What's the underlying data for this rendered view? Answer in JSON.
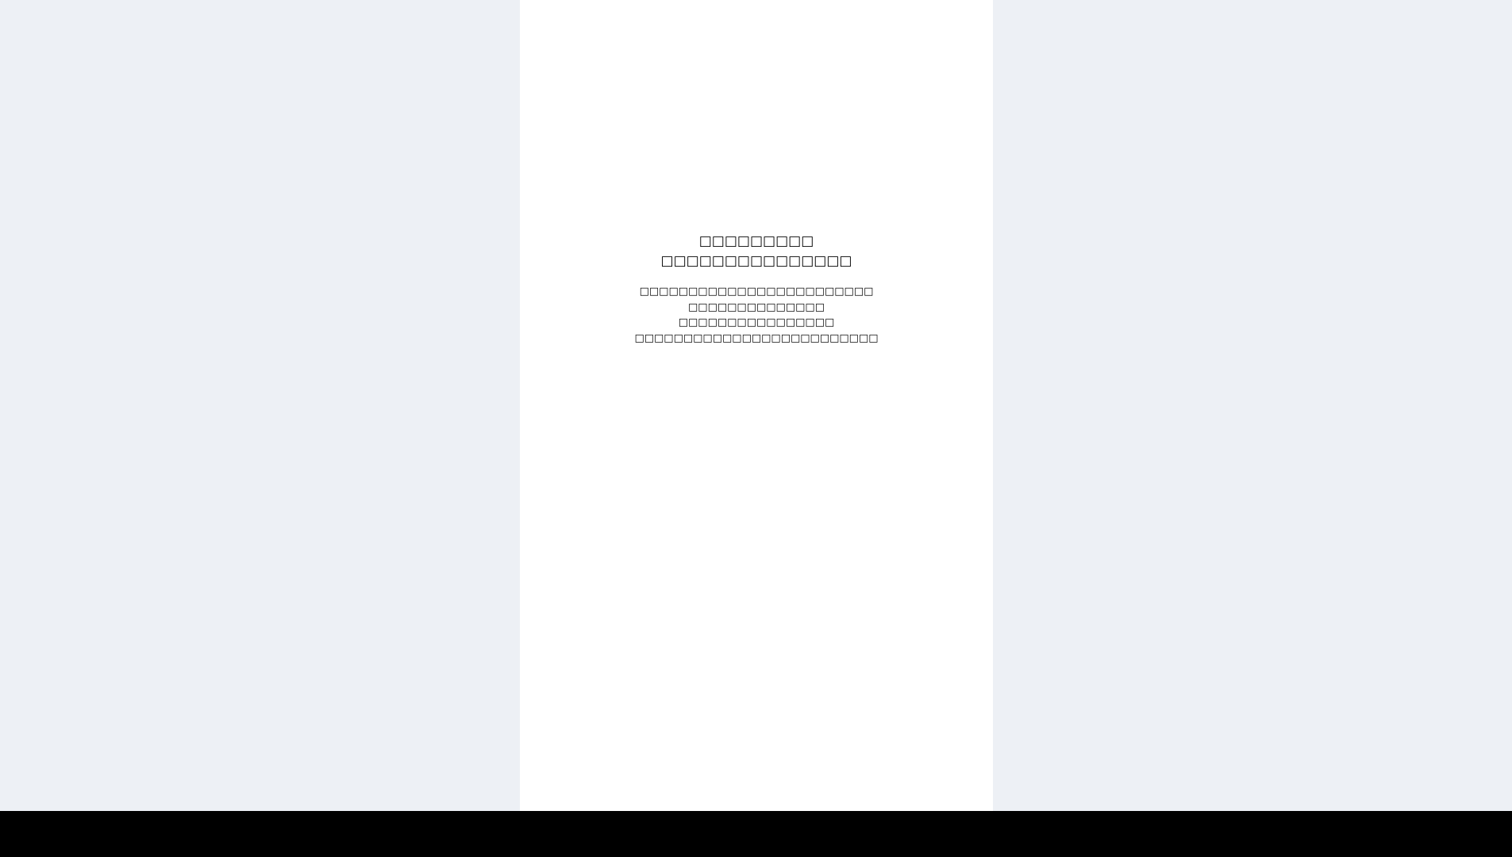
{
  "colors": {
    "page_background": "#edf0f5",
    "content_background": "#ffffff",
    "text": "#000000",
    "bottom_bar": "#000000"
  },
  "message": {
    "title_lines": [
      "□□□□□□□□□",
      "□□□□□□□□□□□□□□□"
    ],
    "body_lines": [
      "□□□□□□□□□□□□□□□□□□□□□□□□",
      "□□□□□□□□□□□□□□",
      "□□□□□□□□□□□□□□□□",
      "□□□□□□□□□□□□□□□□□□□□□□□□□"
    ]
  }
}
